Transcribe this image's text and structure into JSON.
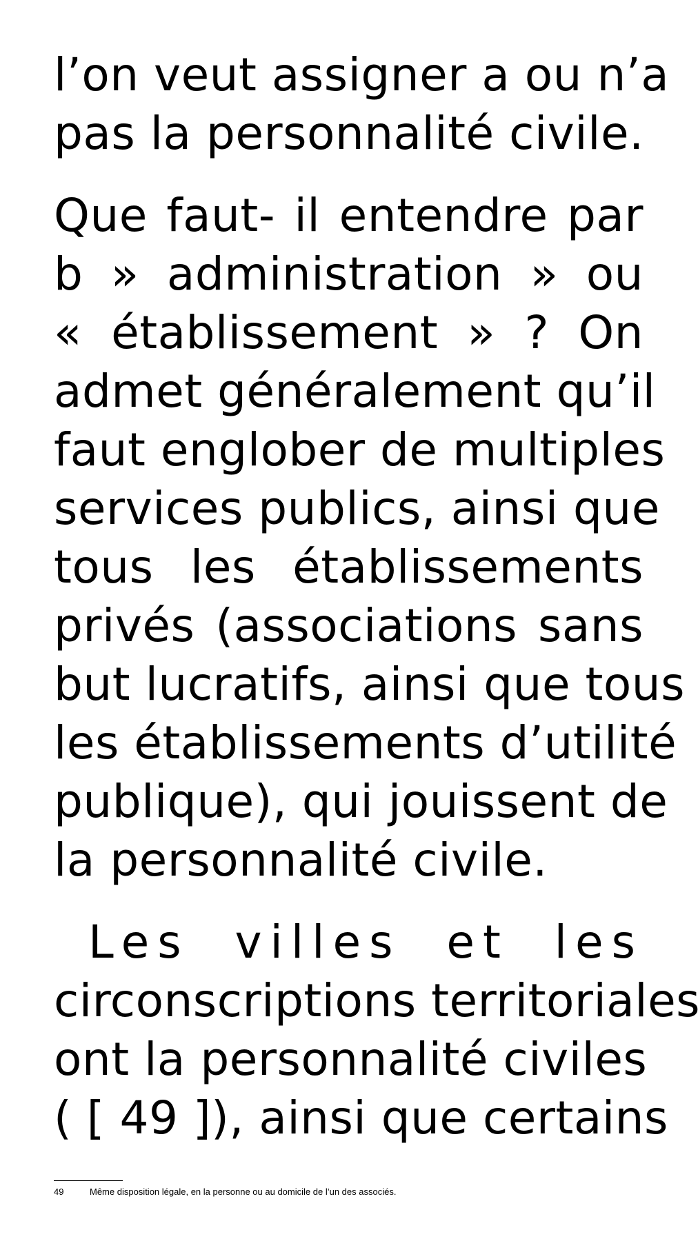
{
  "paragraphs": [
    {
      "lines": [
        "l’on veut assigner a ou n’a",
        "pas la personnalité civile."
      ]
    },
    {
      "lines": [
        "Que faut- il entendre par",
        "b » administration » ou",
        "«  établissement » ? On",
        "admet généralement qu’il",
        "faut englober de multiples",
        "services publics, ainsi que",
        "tous les établissements",
        "privés (associations sans",
        "but lucratifs, ainsi que tous",
        "les établissements d’utilité",
        "publique), qui jouissent de",
        "la  personnalité civile."
      ]
    },
    {
      "lines": [
        "Les villes et les",
        "circonscriptions territoriales",
        "ont la personnalité civiles",
        "( [ 49 ]), ainsi que certains"
      ]
    }
  ],
  "footnotes": [
    {
      "number": "49",
      "text": "Même disposition légale, en la personne ou au domicile de l’un des associés."
    }
  ]
}
